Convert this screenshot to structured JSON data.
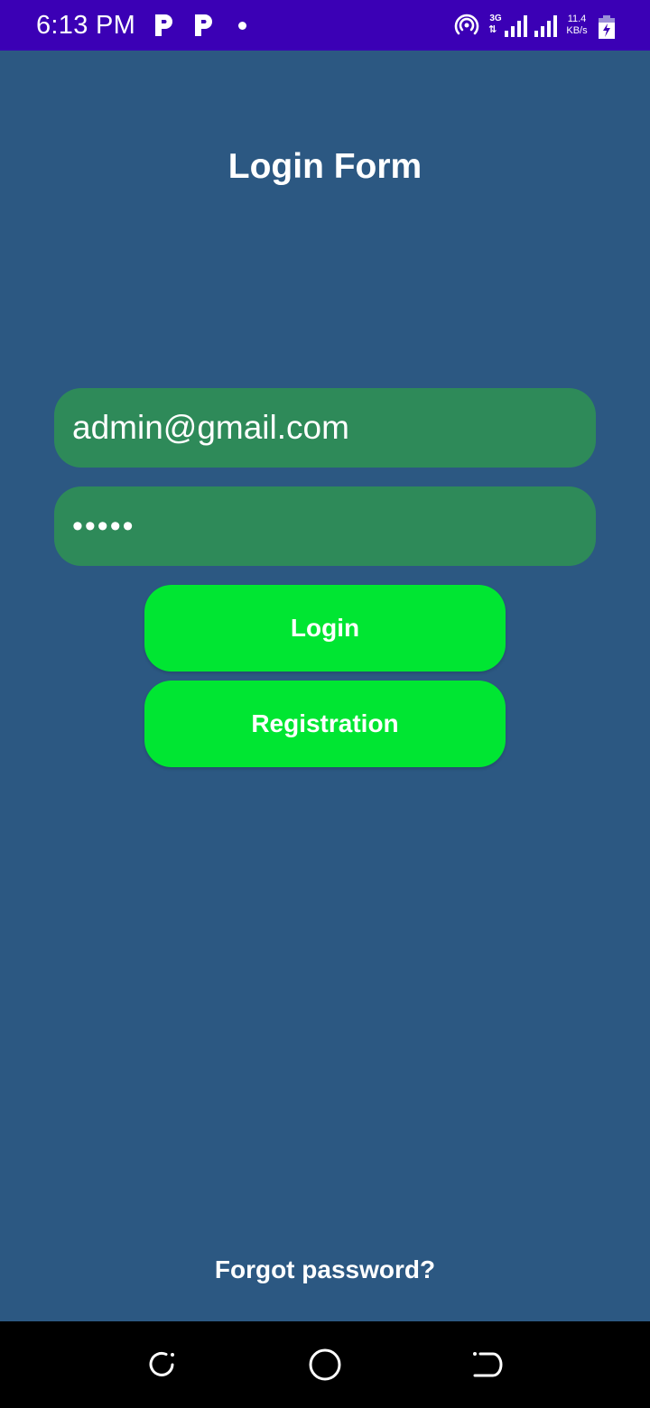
{
  "status_bar": {
    "time": "6:13 PM",
    "network_type": "3G",
    "network_arrows": "⇅",
    "speed_value": "11.4",
    "speed_unit": "KB/s",
    "icons": [
      "p-app-icon",
      "p-app-icon",
      "notification-dot-icon",
      "hotspot-icon",
      "signal-icon",
      "signal-icon",
      "battery-charging-icon"
    ]
  },
  "page": {
    "title": "Login Form"
  },
  "form": {
    "email_value": "admin@gmail.com",
    "password_value": "•••••",
    "login_label": "Login",
    "registration_label": "Registration",
    "forgot_label": "Forgot password?"
  },
  "nav_bar": {
    "icons": [
      "recents-icon",
      "home-icon",
      "back-icon"
    ]
  },
  "colors": {
    "status_bar": "#3b00b5",
    "background": "#2c5882",
    "field": "#2e8a59",
    "button": "#00e632",
    "text": "#ffffff",
    "nav_bar": "#000000"
  }
}
